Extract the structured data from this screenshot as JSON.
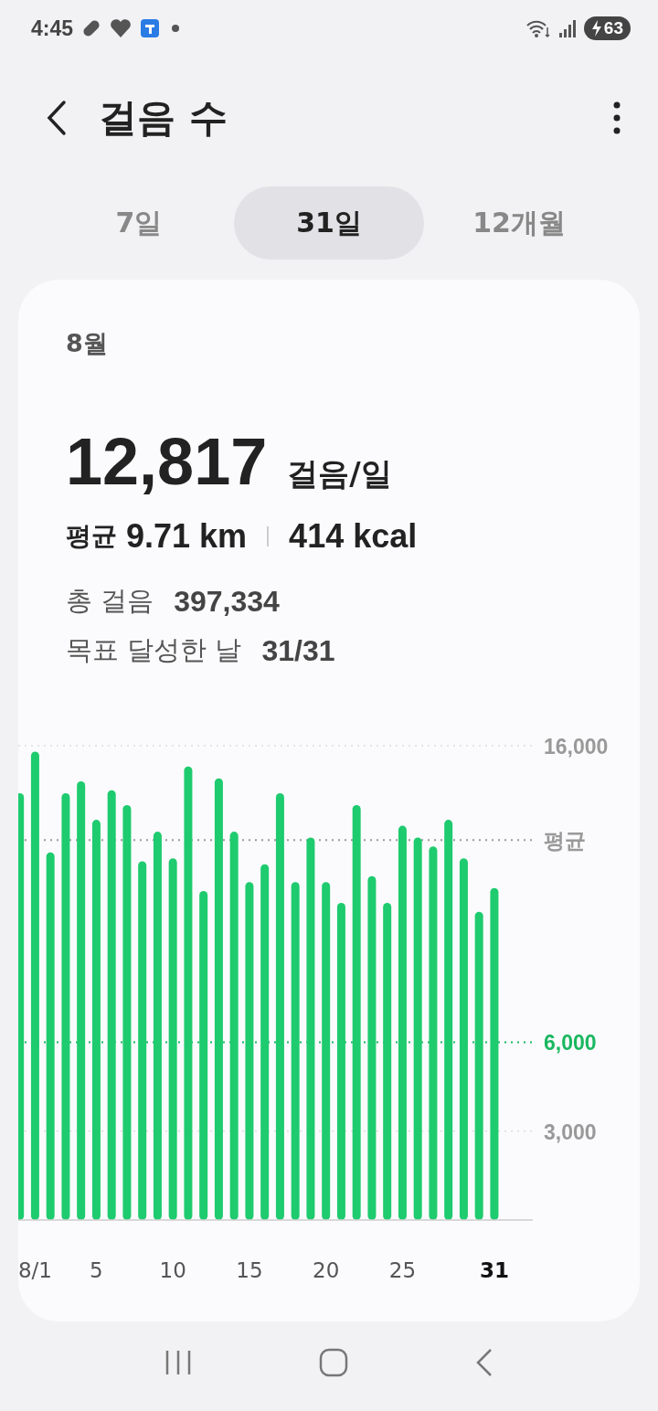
{
  "status_bar": {
    "time": "4:45",
    "battery": "63"
  },
  "header": {
    "title": "걸음 수"
  },
  "tabs": [
    {
      "label": "7일",
      "selected": false
    },
    {
      "label": "31일",
      "selected": true
    },
    {
      "label": "12개월",
      "selected": false
    }
  ],
  "summary": {
    "period": "8월",
    "value": "12,817",
    "unit": "걸음/일",
    "avg_label": "평균",
    "distance": "9.71 km",
    "calories": "414 kcal",
    "total_label": "총 걸음",
    "total": "397,334",
    "goal_label": "목표 달성한 날",
    "goal": "31/31"
  },
  "chart_data": {
    "type": "bar",
    "x": [
      0,
      1,
      2,
      3,
      4,
      5,
      6,
      7,
      8,
      9,
      10,
      11,
      12,
      13,
      14,
      15,
      16,
      17,
      18,
      19,
      20,
      21,
      22,
      23,
      24,
      25,
      26,
      27,
      28,
      29,
      30,
      31
    ],
    "series": [
      {
        "color": "#1ecb6e",
        "values": [
          14400,
          15800,
          12400,
          14400,
          14800,
          13500,
          14500,
          14000,
          12100,
          13100,
          12200,
          15300,
          11100,
          14900,
          13100,
          11400,
          12000,
          14400,
          11400,
          12900,
          11400,
          10700,
          14000,
          11600,
          10700,
          13300,
          12900,
          12600,
          13500,
          12200,
          10400,
          11200
        ]
      }
    ],
    "xlim": [
      -0.1,
      33.5
    ],
    "ylim": [
      0,
      16000
    ],
    "grid": "y",
    "yticks": [
      {
        "value": 3000,
        "label": "3,000"
      },
      {
        "value": 16000,
        "label": "16,000"
      }
    ],
    "ref_lines": [
      {
        "axis": "y",
        "value": 6000,
        "label": "6,000",
        "color": "#1ab760"
      },
      {
        "axis": "y",
        "value": 12817,
        "label": "평균",
        "color": "#999999"
      }
    ],
    "xticks": [
      {
        "value": 1,
        "label": "8/1"
      },
      {
        "value": 5,
        "label": "5"
      },
      {
        "value": 10,
        "label": "10"
      },
      {
        "value": 15,
        "label": "15"
      },
      {
        "value": 20,
        "label": "20"
      },
      {
        "value": 25,
        "label": "25"
      },
      {
        "value": 31,
        "label": "31"
      }
    ]
  }
}
